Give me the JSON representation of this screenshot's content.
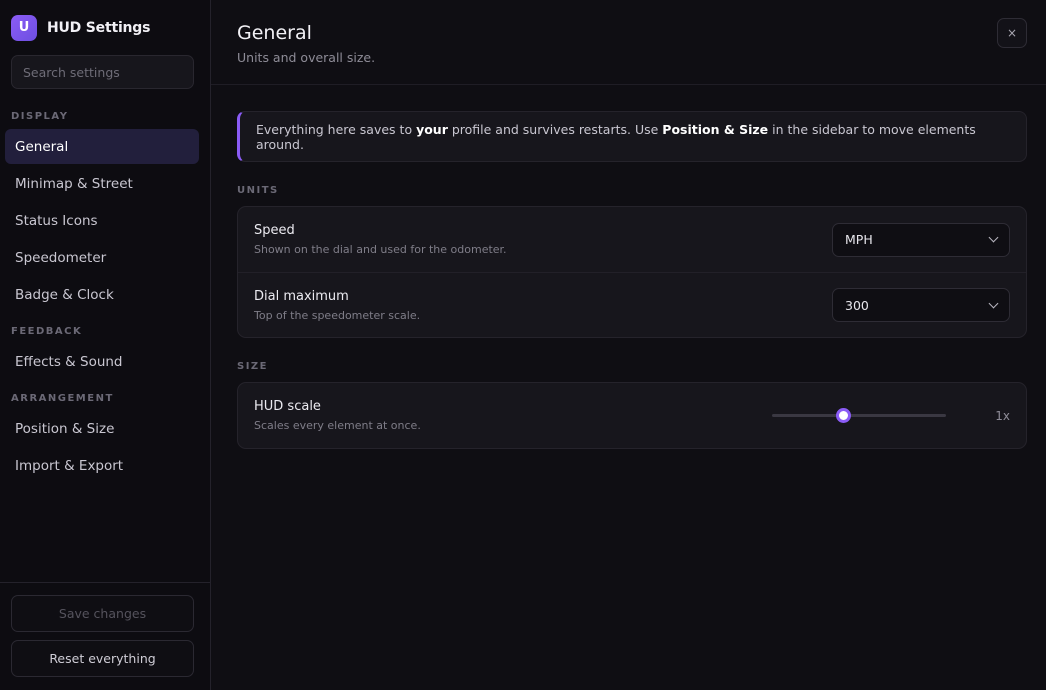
{
  "brand": {
    "logo_letter": "U",
    "title": "HUD Settings"
  },
  "search": {
    "placeholder": "Search settings",
    "value": ""
  },
  "nav": {
    "sections": [
      {
        "label": "DISPLAY",
        "items": [
          "General",
          "Minimap & Street",
          "Status Icons",
          "Speedometer",
          "Badge & Clock"
        ]
      },
      {
        "label": "FEEDBACK",
        "items": [
          "Effects & Sound"
        ]
      },
      {
        "label": "ARRANGEMENT",
        "items": [
          "Position & Size",
          "Import & Export"
        ]
      }
    ],
    "active": "General"
  },
  "footer": {
    "save_label": "Save changes",
    "reset_label": "Reset everything"
  },
  "header": {
    "title": "General",
    "subtitle": "Units and overall size.",
    "close_glyph": "×"
  },
  "callout": {
    "text_1": "Everything here saves to ",
    "bold_1": "your",
    "text_2": " profile and survives restarts. Use ",
    "bold_2": "Position & Size",
    "text_3": " in the sidebar to move elements around.",
    "accent_color": "#8b5cf6"
  },
  "units": {
    "label": "UNITS",
    "speed": {
      "title": "Speed",
      "desc": "Shown on the dial and used for the odometer.",
      "value": "MPH"
    },
    "dial": {
      "title": "Dial maximum",
      "desc": "Top of the speedometer scale.",
      "value": "300"
    }
  },
  "size": {
    "label": "SIZE",
    "hud_scale": {
      "title": "HUD scale",
      "desc": "Scales every element at once.",
      "value_label": "1x",
      "fraction": 0.41
    }
  }
}
